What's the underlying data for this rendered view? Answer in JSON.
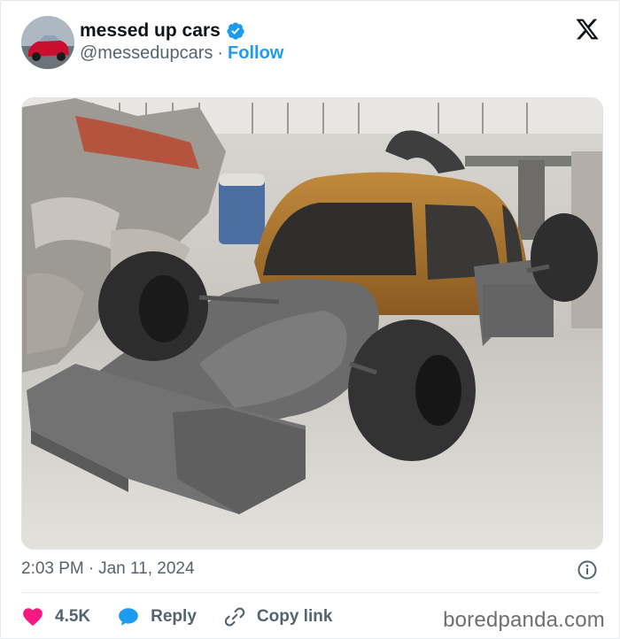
{
  "author": {
    "display_name": "messed up cars",
    "handle": "@messedupcars",
    "separator": "·",
    "follow_label": "Follow"
  },
  "post": {
    "image_alt": "Volkswagen Beetle converted into a Formula 1 style car in a workshop",
    "time": "2:03 PM",
    "date_separator": "·",
    "date": "Jan 11, 2024"
  },
  "actions": {
    "likes_count": "4.5K",
    "reply_label": "Reply",
    "copy_link_label": "Copy link"
  },
  "watermark": "boredpanda.com",
  "colors": {
    "accent": "#1d9bf0",
    "like": "#f91880",
    "text": "#0f1419",
    "muted": "#536471"
  },
  "icons": [
    "verified-badge-icon",
    "x-logo-icon",
    "info-icon",
    "heart-icon",
    "reply-bubble-icon",
    "link-icon"
  ]
}
